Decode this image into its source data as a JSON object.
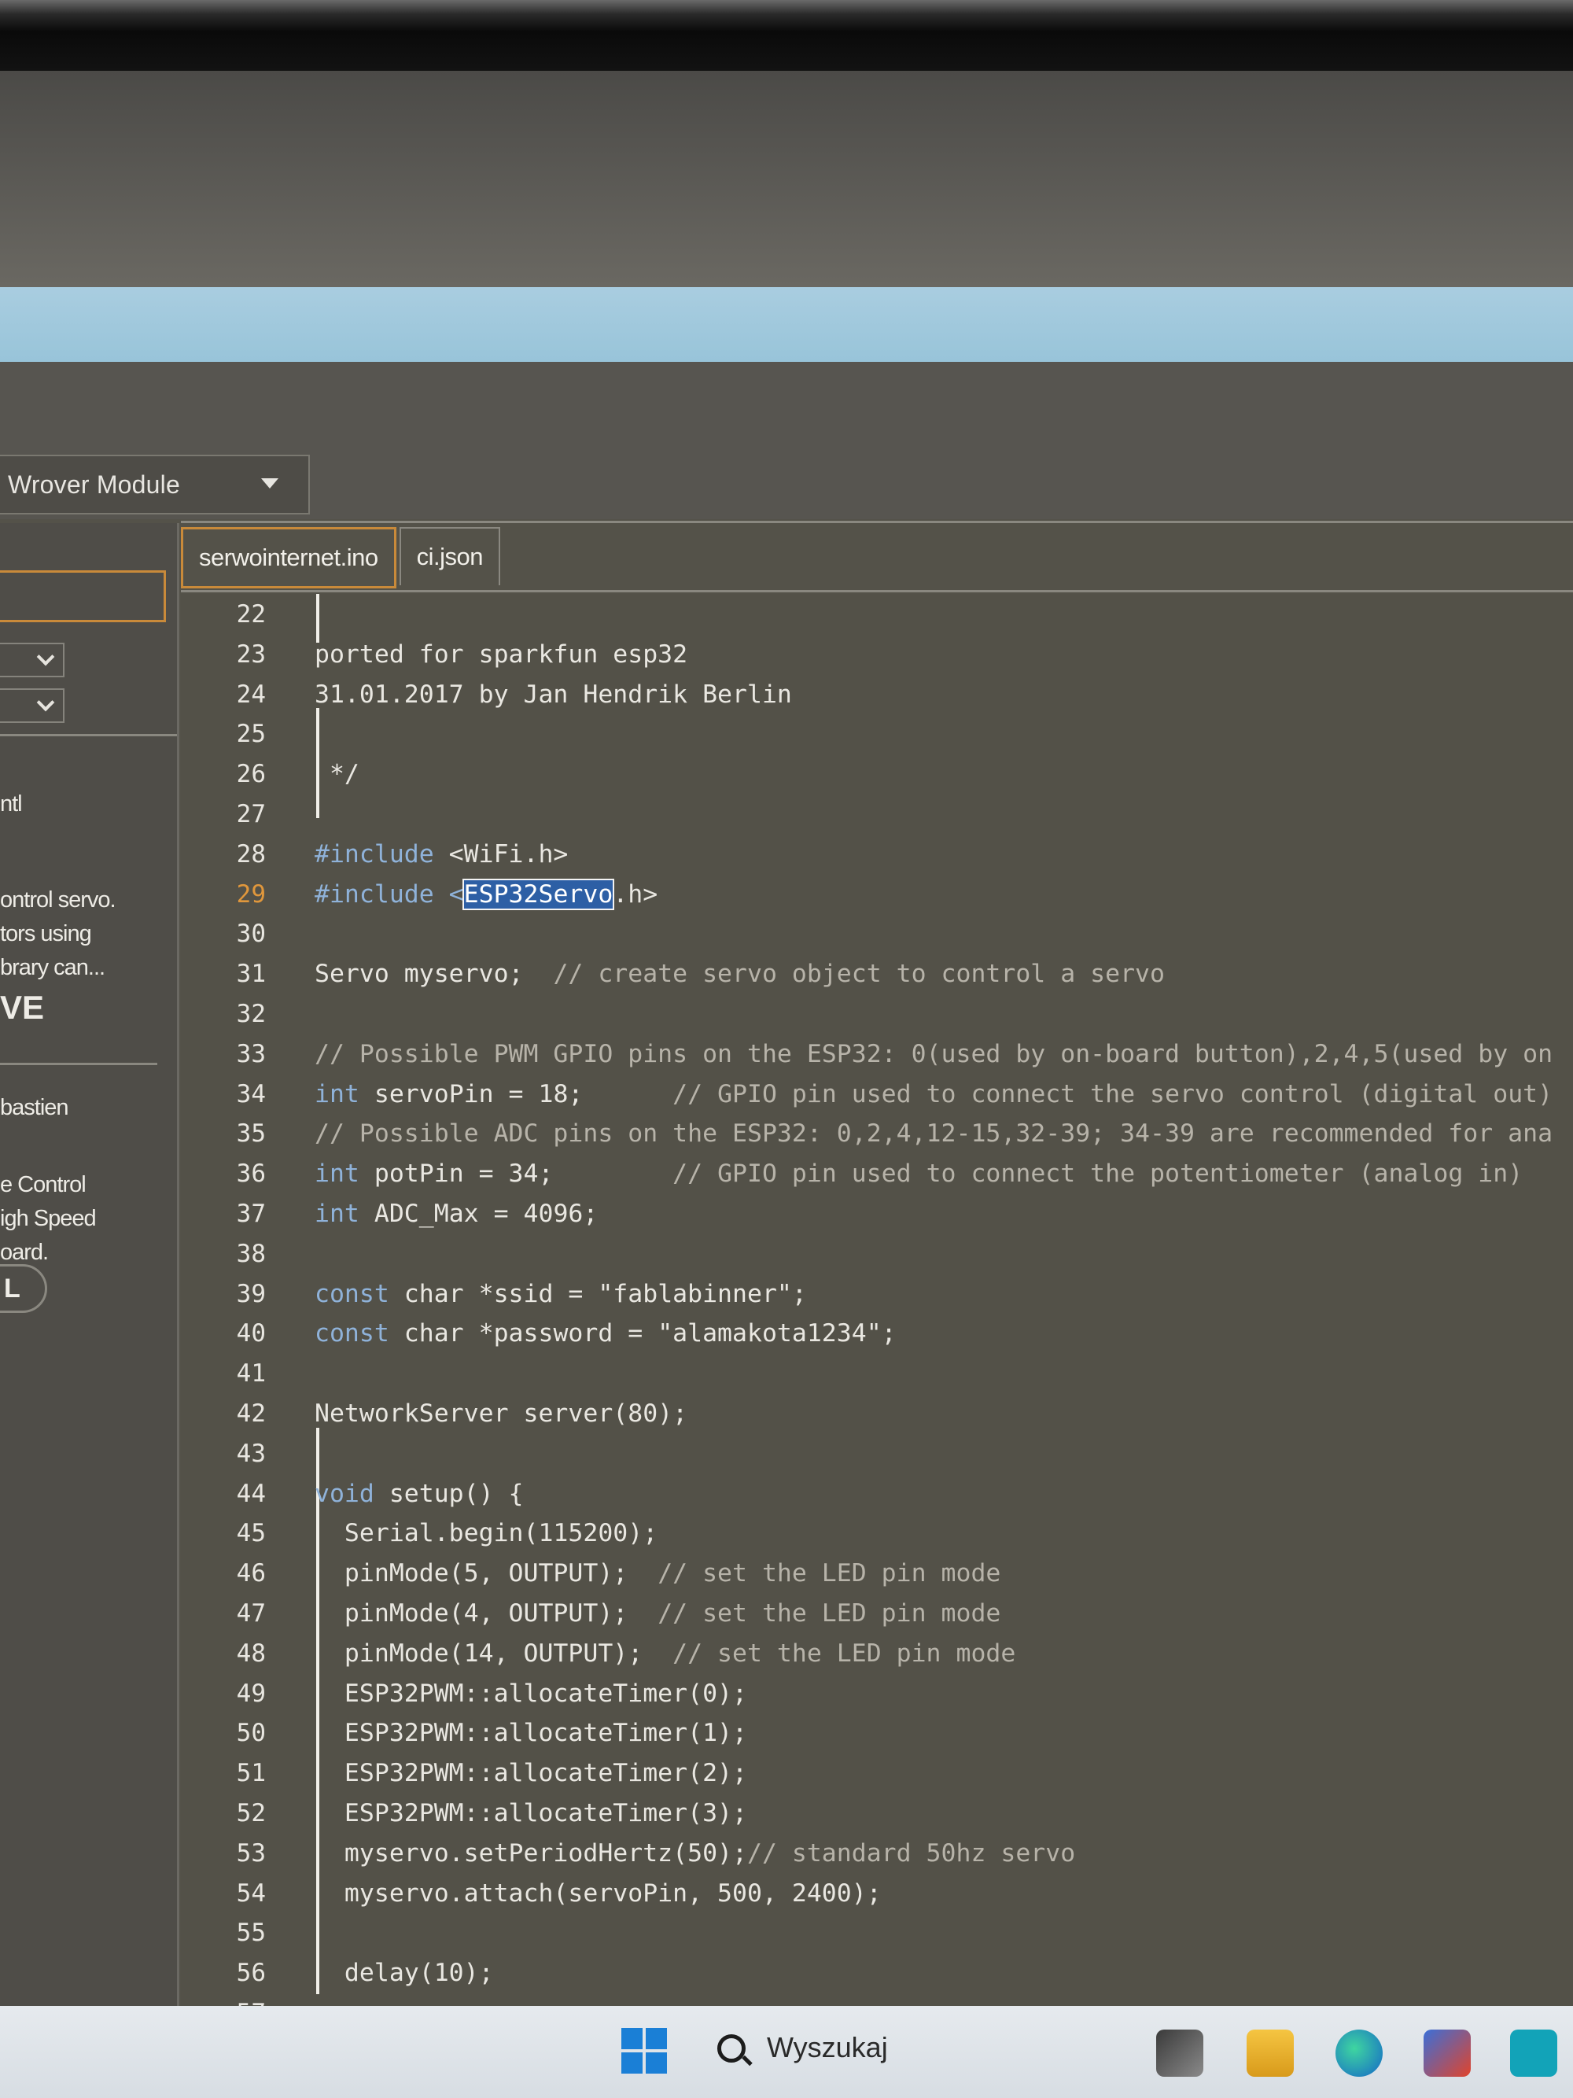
{
  "ide": {
    "board": "Wrover Module",
    "tabs": [
      {
        "label": "serwointernet.ino",
        "active": true
      },
      {
        "label": "ci.json",
        "active": false
      }
    ],
    "current_line": 29,
    "lines": [
      {
        "n": 22,
        "text": ""
      },
      {
        "n": 23,
        "text": "ported for sparkfun esp32"
      },
      {
        "n": 24,
        "text": "31.01.2017 by Jan Hendrik Berlin"
      },
      {
        "n": 25,
        "text": ""
      },
      {
        "n": 26,
        "text": " */"
      },
      {
        "n": 27,
        "text": ""
      },
      {
        "n": 28,
        "text": "#include <WiFi.h>"
      },
      {
        "n": 29,
        "pre": "#include <",
        "highlight": "ESP32Servo",
        "post": ".h>"
      },
      {
        "n": 30,
        "text": ""
      },
      {
        "n": 31,
        "text": "Servo myservo;  ",
        "comment": "// create servo object to control a servo"
      },
      {
        "n": 32,
        "text": ""
      },
      {
        "n": 33,
        "text": "",
        "comment": "// Possible PWM GPIO pins on the ESP32: 0(used by on-board button),2,4,5(used by on"
      },
      {
        "n": 34,
        "text": "int servoPin = 18;      ",
        "comment": "// GPIO pin used to connect the servo control (digital out)"
      },
      {
        "n": 35,
        "text": "",
        "comment": "// Possible ADC pins on the ESP32: 0,2,4,12-15,32-39; 34-39 are recommended for ana"
      },
      {
        "n": 36,
        "text": "int potPin = 34;        ",
        "comment": "// GPIO pin used to connect the potentiometer (analog in)"
      },
      {
        "n": 37,
        "text": "int ADC_Max = 4096;"
      },
      {
        "n": 38,
        "text": ""
      },
      {
        "n": 39,
        "text": "const char *ssid = \"fablabinner\";"
      },
      {
        "n": 40,
        "text": "const char *password = \"alamakota1234\";"
      },
      {
        "n": 41,
        "text": ""
      },
      {
        "n": 42,
        "text": "NetworkServer server(80);"
      },
      {
        "n": 43,
        "text": ""
      },
      {
        "n": 44,
        "text": "void setup() {"
      },
      {
        "n": 45,
        "text": "  Serial.begin(115200);"
      },
      {
        "n": 46,
        "text": "  pinMode(5, OUTPUT);  ",
        "comment": "// set the LED pin mode"
      },
      {
        "n": 47,
        "text": "  pinMode(4, OUTPUT);  ",
        "comment": "// set the LED pin mode"
      },
      {
        "n": 48,
        "text": "  pinMode(14, OUTPUT);  ",
        "comment": "// set the LED pin mode"
      },
      {
        "n": 49,
        "text": "  ESP32PWM::allocateTimer(0);"
      },
      {
        "n": 50,
        "text": "  ESP32PWM::allocateTimer(1);"
      },
      {
        "n": 51,
        "text": "  ESP32PWM::allocateTimer(2);"
      },
      {
        "n": 52,
        "text": "  ESP32PWM::allocateTimer(3);"
      },
      {
        "n": 53,
        "text": "  myservo.setPeriodHertz(50);",
        "comment": "// standard 50hz servo"
      },
      {
        "n": 54,
        "text": "  myservo.attach(servoPin, 500, 2400);"
      },
      {
        "n": 55,
        "text": ""
      },
      {
        "n": 56,
        "text": "  delay(10);"
      },
      {
        "n": 57,
        "text": ""
      }
    ]
  },
  "sidebar": {
    "snippet1": "ntl",
    "snippet2": "ontrol servo.\ntors using\nbrary can...",
    "snippet3": "VE",
    "snippet4": "bastien",
    "snippet5": "e Control\nigh Speed\noard.",
    "pill": "L"
  },
  "taskbar": {
    "search_placeholder": "Wyszukaj",
    "accent": "#1a7fd6"
  }
}
